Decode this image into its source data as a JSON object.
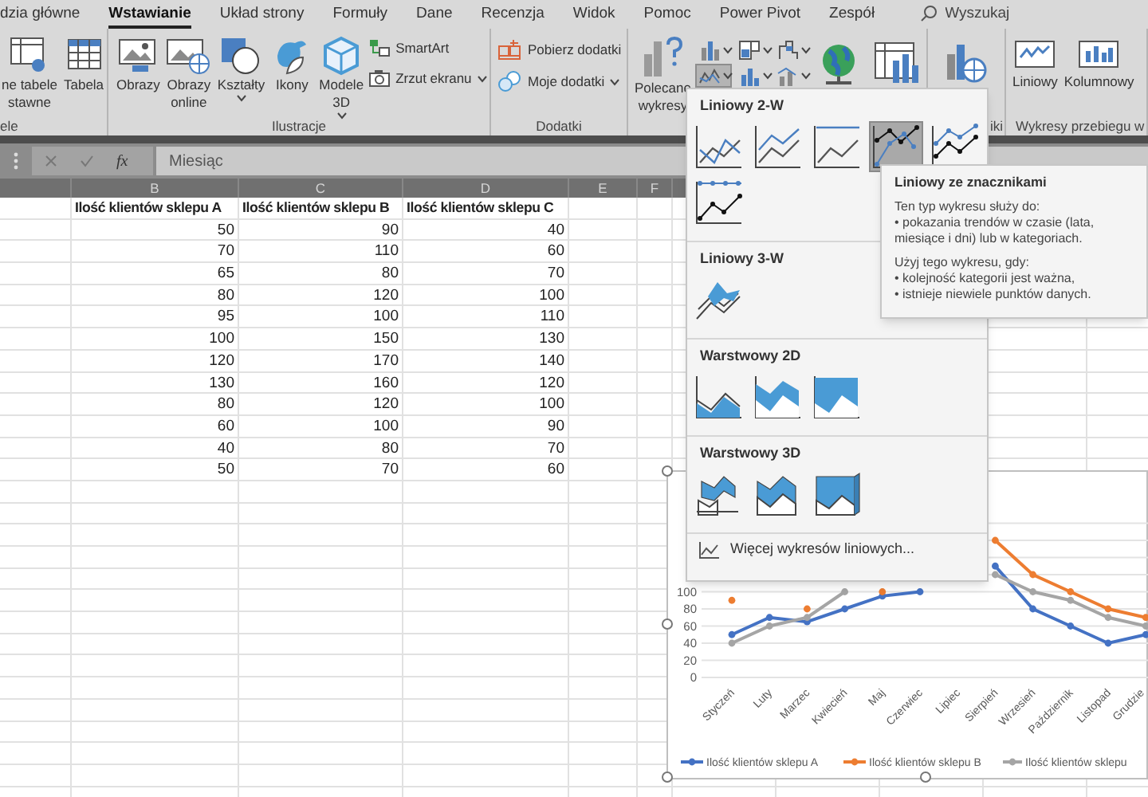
{
  "ribbon_tabs": [
    {
      "label": "dzia główne",
      "selected": false
    },
    {
      "label": "Wstawianie",
      "selected": true
    },
    {
      "label": "Układ strony",
      "selected": false
    },
    {
      "label": "Formuły",
      "selected": false
    },
    {
      "label": "Dane",
      "selected": false
    },
    {
      "label": "Recenzja",
      "selected": false
    },
    {
      "label": "Widok",
      "selected": false
    },
    {
      "label": "Pomoc",
      "selected": false
    },
    {
      "label": "Power Pivot",
      "selected": false
    },
    {
      "label": "Zespół",
      "selected": false
    }
  ],
  "search": {
    "placeholder": "Wyszukaj"
  },
  "ribbon_groups": [
    {
      "label": "ele",
      "items": [
        {
          "kind": "large",
          "label": "ne tabele\nstawne"
        },
        {
          "kind": "large",
          "label": "Tabela"
        }
      ]
    },
    {
      "label": "Ilustracje",
      "items": [
        {
          "kind": "large",
          "label": "Obrazy"
        },
        {
          "kind": "large",
          "label": "Obrazy\nonline"
        },
        {
          "kind": "large",
          "label": "Kształty",
          "dropdown": true
        },
        {
          "kind": "large",
          "label": "Ikony"
        },
        {
          "kind": "large",
          "label": "Modele\n3D",
          "dropdown": true
        },
        {
          "kind": "small",
          "label": "SmartArt"
        },
        {
          "kind": "small",
          "label": "Zrzut ekranu",
          "dropdown": true
        }
      ]
    },
    {
      "label": "Dodatki",
      "items": [
        {
          "kind": "small",
          "label": "Pobierz dodatki"
        },
        {
          "kind": "small",
          "label": "Moje dodatki",
          "dropdown": true
        }
      ]
    },
    {
      "items": [
        {
          "kind": "large",
          "label": "Polecane\nwykresy"
        },
        {
          "kind": "gallery",
          "options": [
            {
              "selected": false
            },
            {
              "selected": false
            },
            {
              "selected": false
            },
            {
              "selected": true
            },
            {
              "selected": false
            },
            {
              "selected": false
            }
          ]
        },
        {
          "kind": "icon"
        },
        {
          "kind": "icon"
        }
      ]
    },
    {
      "label": "iki",
      "items": [
        {
          "kind": "icon"
        }
      ]
    },
    {
      "label": "Wykresy przebiegu w",
      "items": [
        {
          "kind": "large",
          "label": "Liniowy"
        },
        {
          "kind": "large",
          "label": "Kolumnowy"
        }
      ]
    }
  ],
  "formula_bar": {
    "function_button": "fx",
    "value": "Miesiąc"
  },
  "sheet": {
    "columns": [
      "B",
      "C",
      "D",
      "E",
      "F"
    ],
    "header": [
      "Ilość klientów sklepu A",
      "Ilość klientów sklepu B",
      "Ilość klientów sklepu C"
    ],
    "rows": [
      [
        "50",
        "90",
        "40"
      ],
      [
        "70",
        "110",
        "60"
      ],
      [
        "65",
        "80",
        "70"
      ],
      [
        "80",
        "120",
        "100"
      ],
      [
        "95",
        "100",
        "110"
      ],
      [
        "100",
        "150",
        "130"
      ],
      [
        "120",
        "170",
        "140"
      ],
      [
        "130",
        "160",
        "120"
      ],
      [
        "80",
        "120",
        "100"
      ],
      [
        "60",
        "100",
        "90"
      ],
      [
        "40",
        "80",
        "70"
      ],
      [
        "50",
        "70",
        "60"
      ]
    ]
  },
  "chart": {
    "chart_data": {
      "type": "line",
      "categories": [
        "Styczeń",
        "Luty",
        "Marzec",
        "Kwiecień",
        "Maj",
        "Czerwiec",
        "Lipiec",
        "Sierpień",
        "Wrzesień",
        "Październik",
        "Listopad",
        "Grudzie"
      ],
      "series": [
        {
          "name": "Ilość klientów sklepu A",
          "color": "#4472c4",
          "marker": "circle",
          "values": [
            50,
            70,
            65,
            80,
            95,
            100,
            null,
            130,
            80,
            60,
            40,
            50
          ]
        },
        {
          "name": "Ilość klientów sklepu B",
          "color": "#ed7d31",
          "marker": "circle",
          "values": [
            90,
            null,
            80,
            null,
            100,
            null,
            null,
            160,
            120,
            100,
            80,
            70
          ]
        },
        {
          "name": "Ilość klientów sklepu",
          "color": "#a5a5a5",
          "marker": "circle",
          "values": [
            40,
            60,
            70,
            100,
            null,
            null,
            null,
            120,
            100,
            90,
            70,
            60
          ]
        }
      ],
      "ylim": [
        0,
        180
      ],
      "yticks": [
        0,
        20,
        40,
        60,
        80,
        100
      ],
      "grid": true,
      "legend": true
    }
  },
  "chart_menu": {
    "sections": [
      {
        "title": "Liniowy 2-W",
        "options": [
          {
            "kind": "line",
            "selected": false
          },
          {
            "kind": "stacked-line",
            "selected": false
          },
          {
            "kind": "percent-line",
            "selected": false
          },
          {
            "kind": "line-markers",
            "selected": true
          },
          {
            "kind": "stacked-markers",
            "selected": false
          },
          {
            "kind": "percent-markers",
            "selected": false
          }
        ]
      },
      {
        "title": "Liniowy 3-W",
        "options": [
          {
            "kind": "line-3d",
            "selected": false
          }
        ]
      },
      {
        "title": "Warstwowy 2D",
        "options": [
          {
            "kind": "area",
            "selected": false
          },
          {
            "kind": "stacked-area",
            "selected": false
          },
          {
            "kind": "percent-area",
            "selected": false
          }
        ]
      },
      {
        "title": "Warstwowy 3D",
        "options": [
          {
            "kind": "area-3d",
            "selected": false
          },
          {
            "kind": "stacked-area-3d",
            "selected": false
          },
          {
            "kind": "percent-area-3d",
            "selected": false
          }
        ]
      }
    ],
    "more_link": "Więcej wykresów liniowych..."
  },
  "tooltip": {
    "title": "Liniowy ze znacznikami",
    "paragraphs": [
      [
        "Ten typ wykresu służy do:",
        "• pokazania trendów w czasie (lata, miesiące i dni) lub w kategoriach."
      ],
      [
        "Użyj tego wykresu, gdy:",
        "• kolejność kategorii jest ważna,",
        "• istnieje niewiele punktów danych."
      ]
    ]
  }
}
